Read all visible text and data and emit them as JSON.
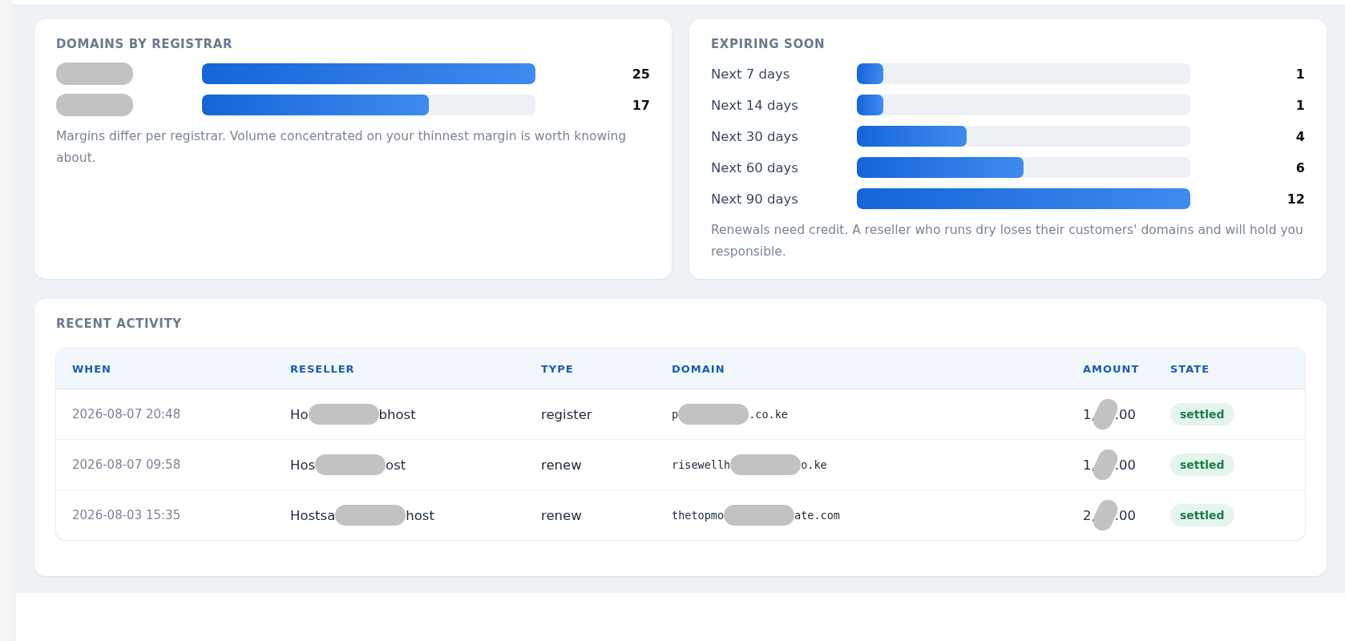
{
  "registrars": {
    "title": "DOMAINS BY REGISTRAR",
    "rows": [
      {
        "name_redacted": true,
        "level": 1.0,
        "count": "25"
      },
      {
        "name_redacted": true,
        "level": 0.68,
        "count": "17"
      }
    ],
    "note": "Margins differ per registrar. Volume concentrated on your thinnest margin is worth knowing about."
  },
  "expiring": {
    "title": "EXPIRING SOON",
    "rows": [
      {
        "label": "Next 7 days",
        "level": 0.08,
        "count": "1"
      },
      {
        "label": "Next 14 days",
        "level": 0.08,
        "count": "1"
      },
      {
        "label": "Next 30 days",
        "level": 0.33,
        "count": "4"
      },
      {
        "label": "Next 60 days",
        "level": 0.5,
        "count": "6"
      },
      {
        "label": "Next 90 days",
        "level": 1.0,
        "count": "12"
      }
    ],
    "note": "Renewals need credit. A reseller who runs dry loses their customers' domains and will hold you responsible."
  },
  "activity": {
    "title": "RECENT ACTIVITY",
    "columns": [
      "WHEN",
      "RESELLER",
      "TYPE",
      "DOMAIN",
      "AMOUNT",
      "STATE"
    ],
    "rows": [
      {
        "when": "2026-08-07 20:48",
        "reseller": [
          "Ho",
          "bhost"
        ],
        "type": "register",
        "domain": [
          "p",
          ".co.ke"
        ],
        "amount": [
          "1,",
          ".00"
        ],
        "state": "settled"
      },
      {
        "when": "2026-08-07 09:58",
        "reseller": [
          "Hos",
          "ost"
        ],
        "type": "renew",
        "domain": [
          "risewellh",
          "o.ke"
        ],
        "amount": [
          "1,",
          ".00"
        ],
        "state": "settled"
      },
      {
        "when": "2026-08-03 15:35",
        "reseller": [
          "Hostsa",
          "host"
        ],
        "type": "renew",
        "domain": [
          "thetopmo",
          "ate.com"
        ],
        "amount": [
          "2,",
          ".00"
        ],
        "state": "settled"
      }
    ]
  }
}
